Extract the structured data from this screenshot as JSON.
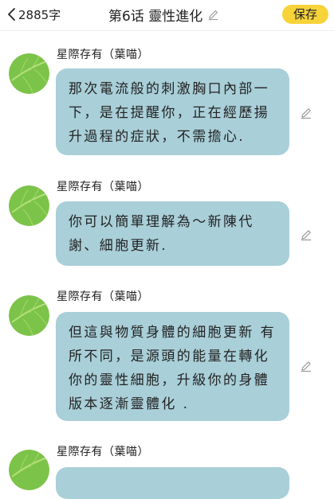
{
  "header": {
    "back_label": "2885字",
    "title": "第6话 靈性進化",
    "save_label": "保存"
  },
  "colors": {
    "bubble": "#a9cfd8",
    "accent": "#f7d33a",
    "avatar": "#7cc34a"
  },
  "messages": [
    {
      "sender": "星際存有（葉喵）",
      "text": "那次電流般的刺激胸口內部一下，是在提醒你，正在經歷揚升過程的症狀，不需擔心."
    },
    {
      "sender": "星際存有（葉喵）",
      "text": "你可以簡單理解為～新陳代謝、細胞更新."
    },
    {
      "sender": "星際存有（葉喵）",
      "text": "但這與物質身體的細胞更新 有所不同，是源頭的能量在轉化你的靈性細胞，升級你的身體版本逐漸靈體化 ."
    },
    {
      "sender": "星際存有（葉喵）",
      "text": ""
    }
  ]
}
